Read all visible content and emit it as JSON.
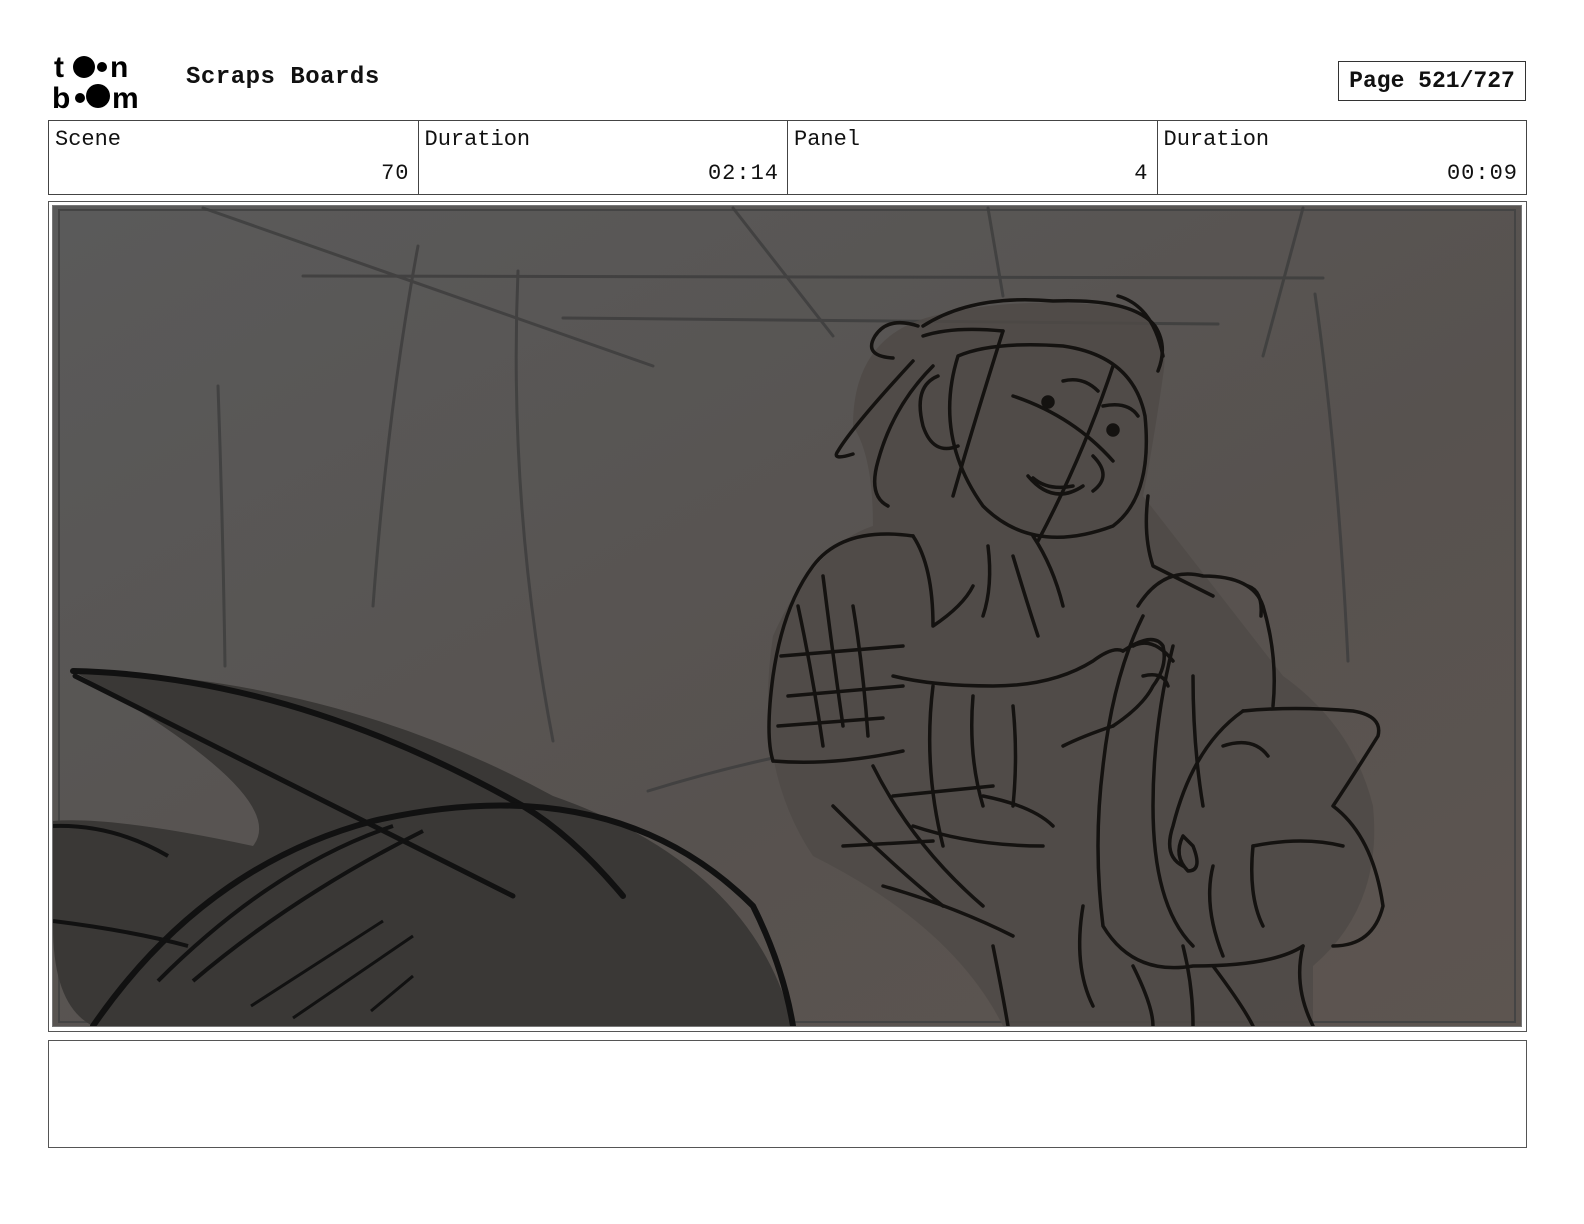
{
  "header": {
    "logo_text_top": "toon",
    "logo_text_bottom": "boom",
    "title": "Scraps Boards",
    "page_label": "Page 521/727"
  },
  "info": {
    "scene_label": "Scene",
    "scene_value": "70",
    "scene_duration_label": "Duration",
    "scene_duration_value": "02:14",
    "panel_label": "Panel",
    "panel_value": "4",
    "panel_duration_label": "Duration",
    "panel_duration_value": "00:09"
  },
  "notes": {
    "text": ""
  }
}
